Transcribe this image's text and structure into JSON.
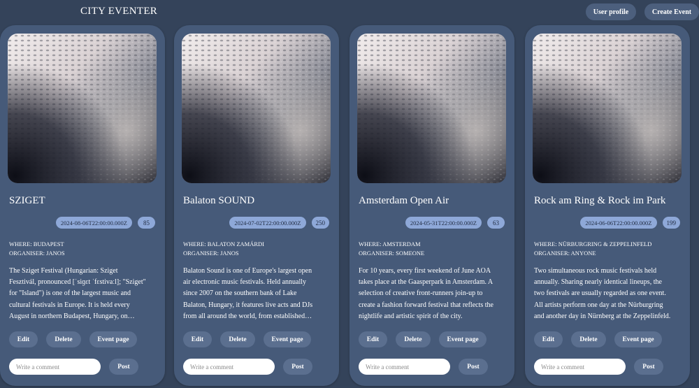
{
  "header": {
    "title": "CITY EVENTER",
    "user_profile": "User profile",
    "create_event": "Create Event"
  },
  "theme": {
    "background": "#34435a",
    "card": "#465a79",
    "badge": "#8ea8d8",
    "button": "#5b6f8f"
  },
  "card_labels": {
    "where": "WHERE:",
    "organiser": "ORGANISER:",
    "edit": "Edit",
    "delete": "Delete",
    "event_page": "Event page",
    "comment_placeholder": "Write a comment",
    "post": "Post"
  },
  "events": [
    {
      "title": "SZIGET",
      "date": "2024-08-06T22:00:00.000Z",
      "count": "85",
      "where": "BUDAPEST",
      "organiser": "JANOS",
      "description": "The Sziget Festival (Hungarian: Sziget Fesztivál, pronounced [ˈsiɡɛt ˈfɛstivaːl]; \"Sziget\" for \"Island\") is one of the largest music and cultural festivals in Europe. It is held every August in northern Budapest, Hungary, on Óbuda Island."
    },
    {
      "title": "Balaton SOUND",
      "date": "2024-07-02T22:00:00.000Z",
      "count": "250",
      "where": "BALATON ZAMÁRDI",
      "organiser": "JANOS",
      "description": "Balaton Sound is one of Europe's largest open air electronic music festivals. Held annually since 2007 on the southern bank of Lake Balaton, Hungary, it features live acts and DJs from all around the world, from established names to new talent."
    },
    {
      "title": "Amsterdam Open Air",
      "date": "2024-05-31T22:00:00.000Z",
      "count": "63",
      "where": "AMSTERDAM",
      "organiser": "SOMEONE",
      "description": "For 10 years, every first weekend of June AOA takes place at the Gaasperpark in Amsterdam. A selection of creative front-runners join-up to create a fashion forward festival that reflects the nightlife and artistic spirit of the city."
    },
    {
      "title": "Rock am Ring & Rock im Park",
      "date": "2024-06-06T22:00:00.000Z",
      "count": "199",
      "where": "NÜRBURGRING & ZEPPELINFELD",
      "organiser": "ANYONE",
      "description": "Two simultaneous rock music festivals held annually. Sharing nearly identical lineups, the two festivals are usually regarded as one event. All artists perform one day at the Nürburgring and another day in Nürnberg at the Zeppelinfeld."
    }
  ]
}
